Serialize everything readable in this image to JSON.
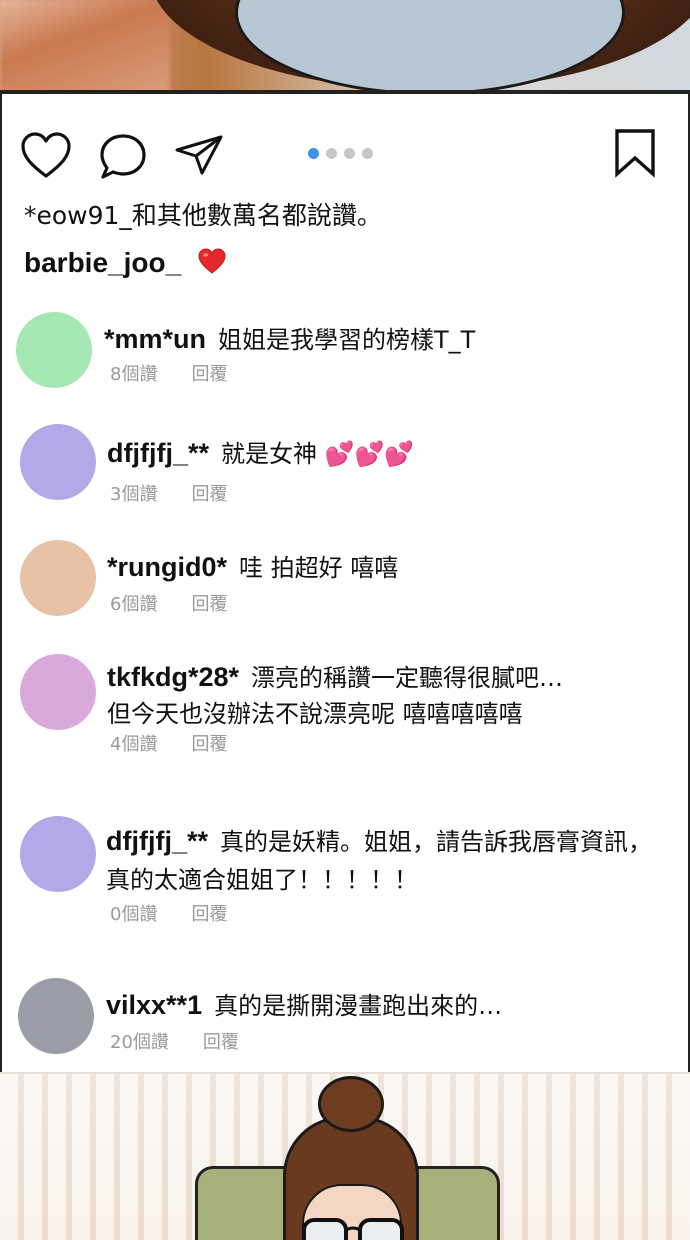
{
  "actions": {
    "like_icon": "heart-outline-icon",
    "comment_icon": "speech-bubble-icon",
    "share_icon": "paper-plane-icon",
    "save_icon": "bookmark-icon",
    "carousel_total": 4,
    "carousel_active_index": 0
  },
  "likes_text": "*eow91_和其他數萬名都說讚。",
  "caption": {
    "username": "barbie_joo_",
    "emoji": "❤️"
  },
  "comments": [
    {
      "username": "*mm*un",
      "lines": [
        "姐姐是我學習的榜樣T_T"
      ],
      "likes": "8個讚",
      "reply": "回覆",
      "avatar_color": "#a6e8b4"
    },
    {
      "username": "dfjfjfj_**",
      "lines": [
        "就是女神 💕💕💕"
      ],
      "likes": "3個讚",
      "reply": "回覆",
      "avatar_color": "#b4a9e8"
    },
    {
      "username": "*rungid0*",
      "lines": [
        "哇 拍超好 嘻嘻"
      ],
      "likes": "6個讚",
      "reply": "回覆",
      "avatar_color": "#e8c2a6"
    },
    {
      "username": "tkfkdg*28*",
      "lines": [
        "漂亮的稱讚一定聽得很膩吧…",
        "但今天也沒辦法不說漂亮呢 嘻嘻嘻嘻嘻"
      ],
      "likes": "4個讚",
      "reply": "回覆",
      "avatar_color": "#d9a9dc"
    },
    {
      "username": "dfjfjfj_**",
      "lines": [
        "真的是妖精。姐姐，請告訴我唇膏資訊，",
        "真的太適合姐姐了！！！！！"
      ],
      "likes": "0個讚",
      "reply": "回覆",
      "avatar_color": "#b4a9e8"
    },
    {
      "username": "vilxx**1",
      "lines": [
        "真的是撕開漫畫跑出來的…"
      ],
      "likes": "20個讚",
      "reply": "回覆",
      "avatar_color": "#9a9ea8"
    }
  ]
}
